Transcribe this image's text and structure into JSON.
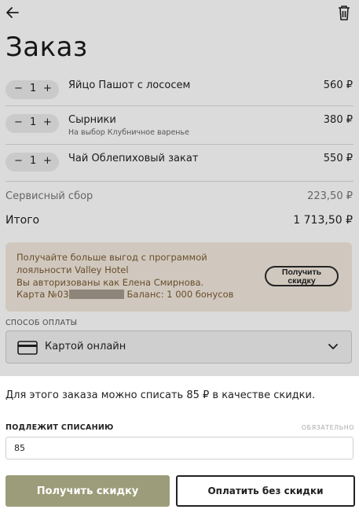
{
  "header": {
    "title": "Заказ",
    "back_icon": "arrow-left-icon",
    "trash_icon": "trash-icon"
  },
  "items": [
    {
      "qty": "1",
      "name": "Яйцо Пашот с лососем",
      "option": "",
      "price": "560 ₽"
    },
    {
      "qty": "1",
      "name": "Сырники",
      "option": "На выбор Клубничное варенье",
      "price": "380 ₽"
    },
    {
      "qty": "1",
      "name": "Чай Облепиховый закат",
      "option": "",
      "price": "550 ₽"
    }
  ],
  "stepper": {
    "minus": "−",
    "plus": "+"
  },
  "summary": {
    "service_label": "Сервисный сбор",
    "service_value": "223,50 ₽",
    "total_label": "Итого",
    "total_value": "1 713,50 ₽"
  },
  "loyalty": {
    "line1": "Получайте больше выгод с программой",
    "line2": "лояльности Valley Hotel",
    "line3": "Вы авторизованы как Елена Смирнова.",
    "card_prefix": "Карта №03",
    "balance": "Баланс: 1 000 бонусов",
    "button_line1": "Получить",
    "button_line2": "скидку"
  },
  "payment": {
    "label": "СПОСОБ ОПЛАТЫ",
    "selected": "Картой онлайн"
  },
  "sheet": {
    "message": "Для этого заказа можно списать 85 ₽ в качестве скидки.",
    "field_label": "ПОДЛЕЖИТ СПИСАНИЮ",
    "field_required": "ОБЯЗАТЕЛЬНО",
    "field_value": "85",
    "primary_button": "Получить скидку",
    "secondary_button": "Оплатить без скидки"
  },
  "colors": {
    "accent": "#9c9c7a",
    "loyalty_bg": "#f3e9de",
    "loyalty_text": "#7a5a32"
  }
}
